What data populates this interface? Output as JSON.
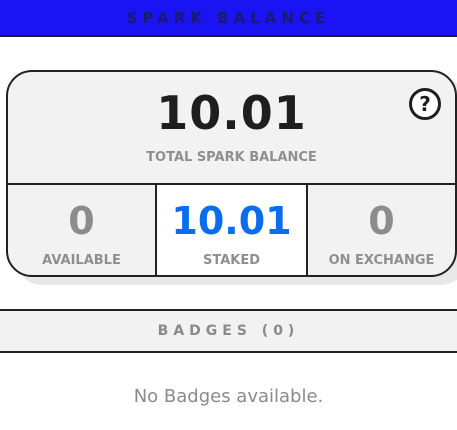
{
  "header": {
    "title": "SPARK BALANCE"
  },
  "balance": {
    "total_value": "10.01",
    "total_label": "TOTAL SPARK BALANCE",
    "help_icon": "?",
    "available_value": "0",
    "available_label": "AVAILABLE",
    "staked_value": "10.01",
    "staked_label": "STAKED",
    "exchange_value": "0",
    "exchange_label": "ON EXCHANGE"
  },
  "badges": {
    "title": "BADGES (0)",
    "empty_message": "No Badges available."
  },
  "colors": {
    "header_bg": "#1a14f5",
    "staked_accent": "#0a6cf0",
    "muted_text": "#8f8f8f"
  }
}
